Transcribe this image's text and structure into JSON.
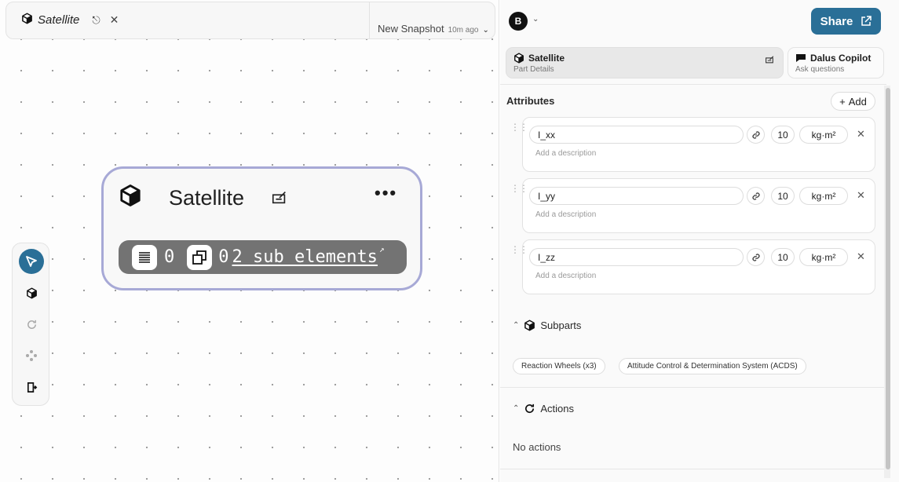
{
  "canvas": {
    "tab": {
      "title": "Satellite"
    },
    "snapshot": {
      "label": "New Snapshot",
      "ago": "10m ago"
    },
    "node": {
      "title": "Satellite",
      "attribute_count": "0",
      "part_count": "0",
      "sub_elements": "2 sub elements"
    },
    "tools": [
      "select-tool",
      "part-tool",
      "action-tool",
      "connect-tool",
      "exit-tool"
    ]
  },
  "panel": {
    "avatar": "B",
    "share_label": "Share",
    "tabs": [
      {
        "title": "Satellite",
        "subtitle": "Part Details"
      },
      {
        "title": "Dalus Copilot",
        "subtitle": "Ask questions"
      }
    ],
    "attributes": {
      "title": "Attributes",
      "add_label": "Add",
      "items": [
        {
          "name": "I_xx",
          "value": "10",
          "unit": "kg·m²",
          "description_placeholder": "Add a description"
        },
        {
          "name": "I_yy",
          "value": "10",
          "unit": "kg·m²",
          "description_placeholder": "Add a description"
        },
        {
          "name": "I_zz",
          "value": "10",
          "unit": "kg·m²",
          "description_placeholder": "Add a description"
        }
      ]
    },
    "subparts": {
      "title": "Subparts",
      "items": [
        "Reaction Wheels (x3)",
        "Attitude Control & Determination System (ACDS)"
      ]
    },
    "actions": {
      "title": "Actions",
      "empty": "No actions"
    }
  },
  "colors": {
    "accent": "#2a6f97",
    "node_border": "#a7a9d6",
    "summary_bar": "#737373"
  }
}
